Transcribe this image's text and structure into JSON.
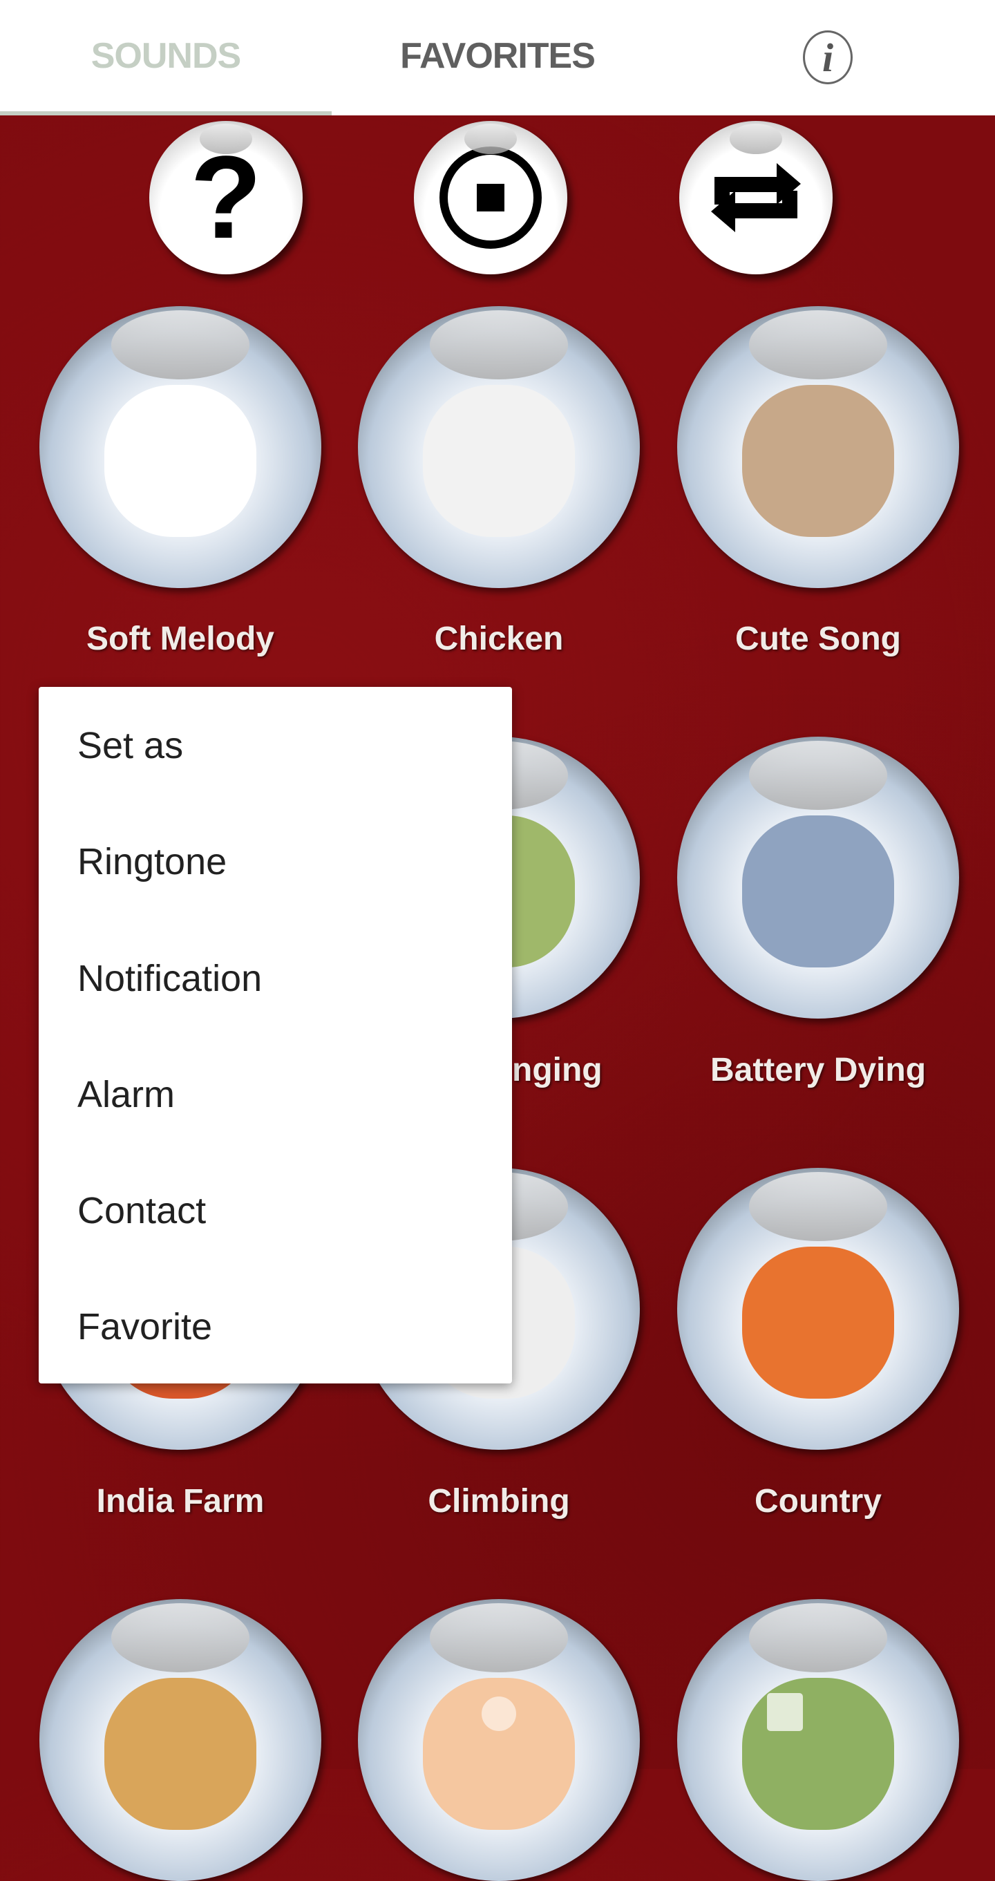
{
  "tabs": {
    "sounds": "SOUNDS",
    "favorites": "FAVORITES",
    "info_icon": "info-icon",
    "active": "SOUNDS"
  },
  "colors": {
    "background": "#7e0b0f",
    "tab_active": "#c5cfc4",
    "tab_inactive": "#5f5f5f"
  },
  "controls": {
    "help_glyph": "?",
    "stop_icon": "stop-icon",
    "repeat_icon": "repeat-icon"
  },
  "sounds": [
    {
      "label": "Soft Melody",
      "pic": "#ffffff"
    },
    {
      "label": "Chicken",
      "pic": "#f2f2f2"
    },
    {
      "label": "Cute Song",
      "pic": "#c7a889"
    },
    {
      "label": "nging",
      "pic": "#9fb86a"
    },
    {
      "label": "Battery Dying",
      "pic": "#8fa3c0"
    },
    {
      "label": "India Farm",
      "pic": "#d9572a"
    },
    {
      "label": "Climbing",
      "pic": "#eeeeee"
    },
    {
      "label": "Country",
      "pic": "#e8732f"
    },
    {
      "label": "",
      "pic": "#d9a55a"
    },
    {
      "label": "",
      "pic": "#f5c7a0"
    },
    {
      "label": "",
      "pic": "#8fb062"
    }
  ],
  "menu": {
    "items": [
      "Set as",
      "Ringtone",
      "Notification",
      "Alarm",
      "Contact",
      "Favorite"
    ]
  }
}
